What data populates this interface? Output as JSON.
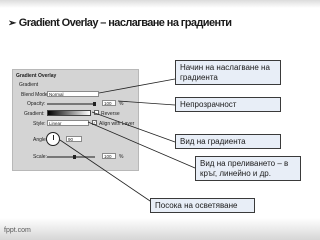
{
  "slide": {
    "title": "Gradient Overlay – наслагване на градиенти"
  },
  "panel": {
    "section_title": "Gradient Overlay",
    "group_title": "Gradient",
    "blend_mode_label": "Blend Mode:",
    "blend_mode_value": "Normal",
    "opacity_label": "Opacity:",
    "opacity_value": "100",
    "opacity_unit": "%",
    "gradient_label": "Gradient:",
    "reverse_label": "Reverse",
    "style_label": "Style:",
    "style_value": "Linear",
    "align_label": "Align with Layer",
    "angle_label": "Angle:",
    "angle_value": "90",
    "scale_label": "Scale:",
    "scale_value": "100",
    "scale_unit": "%"
  },
  "callouts": {
    "blend_mode": "Начин на наслагване на градиента",
    "opacity": "Непрозрачност",
    "gradient_type": "Вид на градиента",
    "style": "Вид на преливането – в кръг, линейно и др.",
    "angle": "Посока на осветяване"
  },
  "footer": {
    "logo": "fppt.com"
  },
  "colors": {
    "callout_bg": "#e8eef7",
    "callout_border": "#3a3a3a",
    "panel_bg": "#d4d4d4"
  }
}
